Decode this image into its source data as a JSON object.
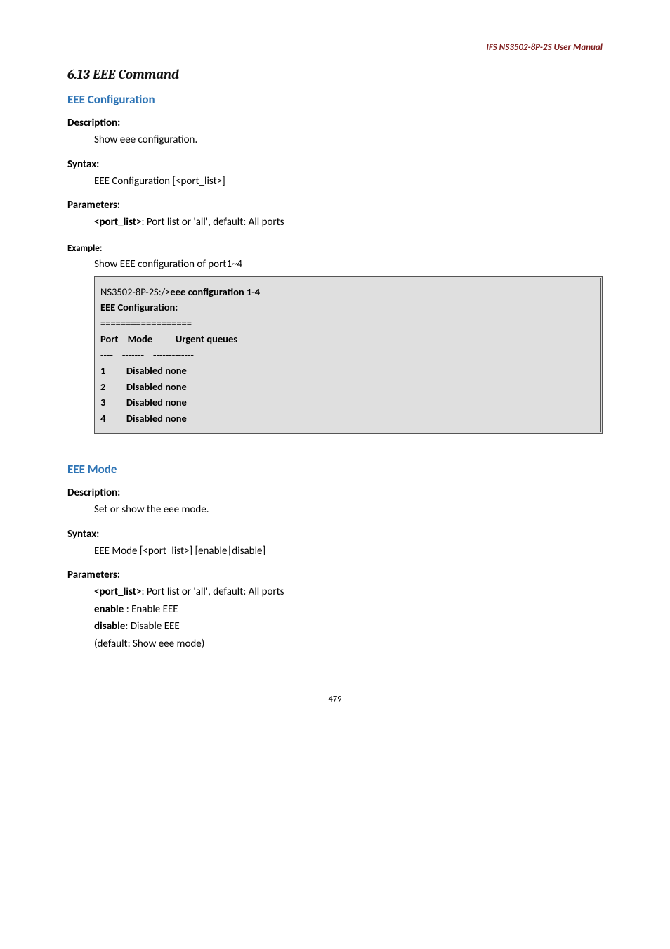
{
  "header": {
    "product": "IFS  NS3502-8P-2S  User  Manual"
  },
  "section": {
    "title": "6.13 EEE Command"
  },
  "eeeConfig": {
    "heading": "EEE Configuration",
    "descLabel": "Description:",
    "descText": "Show eee configuration.",
    "syntaxLabel": "Syntax:",
    "syntaxText": "EEE Configuration [<port_list>]",
    "paramsLabel": "Parameters:",
    "paramLine": "<port_list>: Port list or 'all', default: All ports",
    "paramKey": "<port_list>",
    "paramRest": ": Port list or 'all', default: All ports",
    "exampleLabel": "Example:",
    "exampleText": "Show EEE configuration of port1~4",
    "cli": {
      "prompt": "NS3502-8P-2S:/>",
      "cmd": "eee configuration 1-4",
      "blank1": " ",
      "title": "EEE Configuration:",
      "rule": "==================",
      "blank2": " ",
      "blank3": " ",
      "cols": "Port    Mode          Urgent queues",
      "dash": "----    -------    -------------",
      "rows": [
        "1         Disabled none",
        "2         Disabled none",
        "3         Disabled none",
        "4         Disabled none"
      ]
    }
  },
  "eeeMode": {
    "heading": "EEE Mode",
    "descLabel": "Description:",
    "descText": "Set or show the eee mode.",
    "syntaxLabel": "Syntax:",
    "syntaxText": "EEE Mode [<port_list>] [enable|disable]",
    "paramsLabel": "Parameters:",
    "p1key": "<port_list>",
    "p1rest": ": Port list or 'all', default: All ports",
    "p2key": "enable ",
    "p2rest": ": Enable EEE",
    "p3key": "disable",
    "p3rest": ": Disable EEE",
    "p4": "(default: Show eee mode)"
  },
  "footer": {
    "page": "479"
  }
}
